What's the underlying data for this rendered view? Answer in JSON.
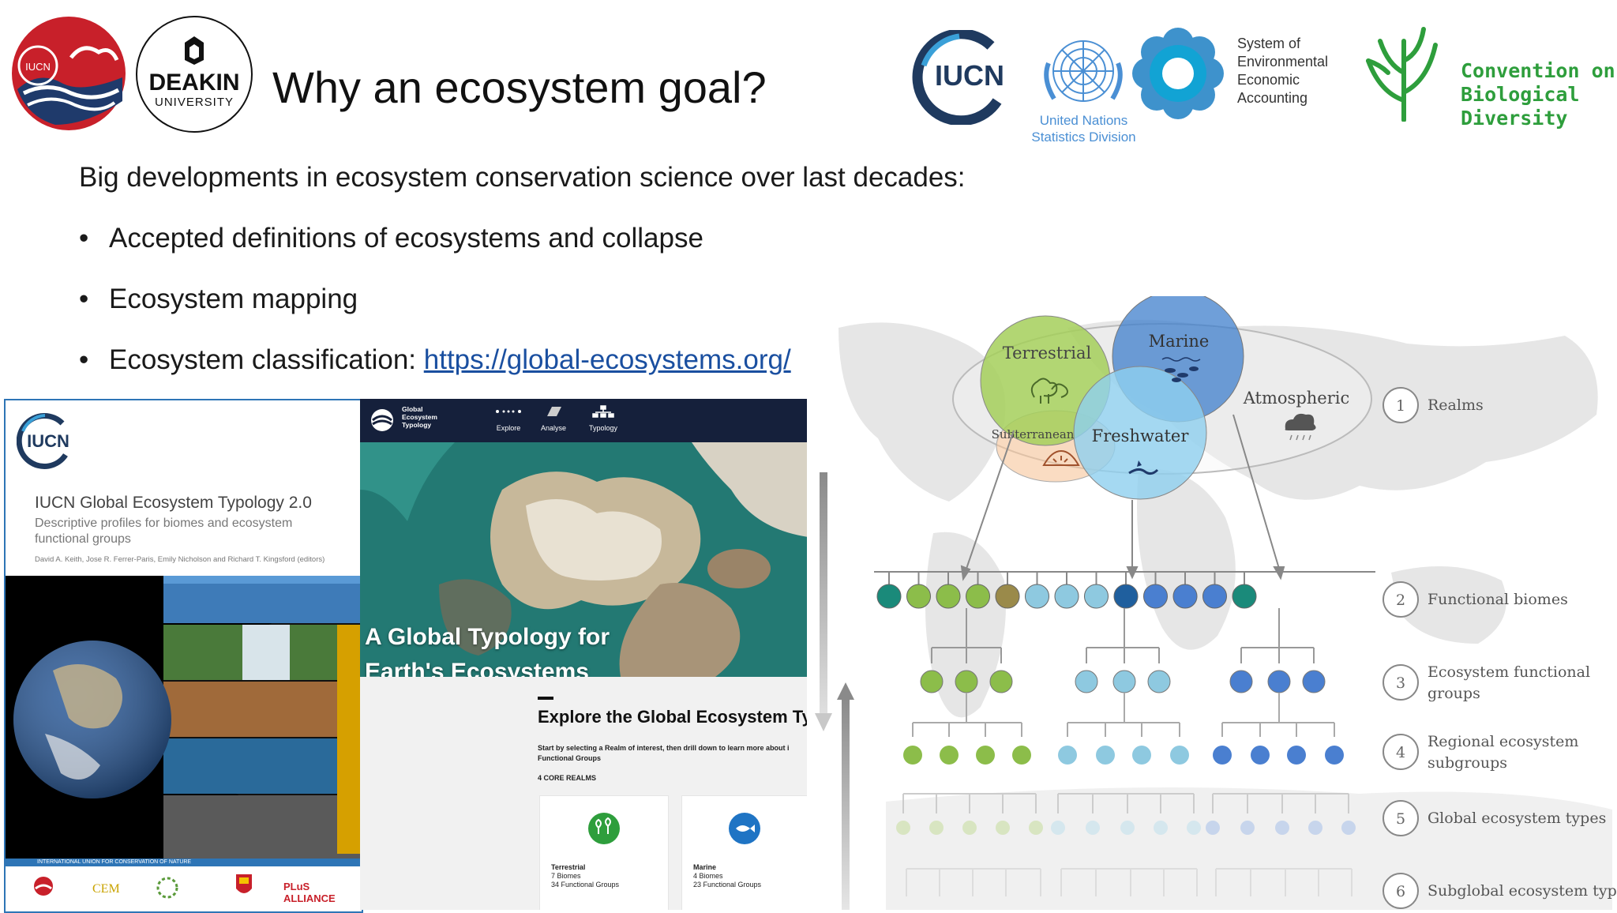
{
  "slide": {
    "title": "Why an ecosystem goal?",
    "intro": "Big developments in ecosystem conservation science over last decades:",
    "bullets": [
      {
        "text": "Accepted definitions of ecosystems and collapse"
      },
      {
        "text": "Ecosystem mapping"
      },
      {
        "text": "Ecosystem classification: ",
        "link": "https://global-ecosystems.org/"
      }
    ]
  },
  "logos": {
    "iucn_small": "IUCN",
    "deakin_name": "DEAKIN",
    "deakin_sub": "UNIVERSITY",
    "iucn": "IUCN",
    "un_line1": "United Nations",
    "un_line2": "Statistics Division",
    "seea": [
      "System of",
      "Environmental",
      "Economic",
      "Accounting"
    ],
    "cbd_line1": "Convention on",
    "cbd_line2": "Biological Diversity",
    "colors": {
      "iucn_blue": "#1f3a5f",
      "cbd_green": "#2e9e3c",
      "un_blue": "#4a8fd4",
      "deakin": "#000000"
    }
  },
  "cover": {
    "logo": "IUCN",
    "title": "IUCN Global Ecosystem Typology 2.0",
    "subtitle": "Descriptive profiles for biomes and ecosystem functional groups",
    "editors": "David A. Keith, Jose R. Ferrer-Paris, Emily Nicholson and Richard T. Kingsford (editors)",
    "footer": "INTERNATIONAL UNION FOR CONSERVATION OF NATURE",
    "partner_logos": [
      "IUCN Red List of Ecosystems",
      "CEM",
      "Centre for Ecosystem Science",
      "UNSW",
      "PLuS ALLIANCE"
    ]
  },
  "website": {
    "brand": [
      "Global",
      "Ecosystem",
      "Typology"
    ],
    "nav": [
      "Explore",
      "Analyse",
      "Typology"
    ],
    "hero_title_line1": "A Global Typology for",
    "hero_title_line2": "Earth's Ecosystems",
    "section_title": "Explore the Global Ecosystem Ty",
    "section_text_line1": "Start by selecting a Realm of interest, then drill down to learn more about i",
    "section_text_line2": "Functional Groups",
    "core_label": "4 CORE REALMS",
    "cards": [
      {
        "name": "Terrestrial",
        "biomes": "7 Biomes",
        "groups": "34 Functional Groups",
        "color": "#2e9e3c",
        "icon": "tree-icon"
      },
      {
        "name": "Marine",
        "biomes": "4 Biomes",
        "groups": "23 Functional Groups",
        "color": "#1f74c4",
        "icon": "fish-icon"
      }
    ]
  },
  "diagram": {
    "realms": [
      "Terrestrial",
      "Marine",
      "Atmospheric",
      "Subterranean",
      "Freshwater"
    ],
    "levels": [
      {
        "num": "1",
        "label": [
          "Realms"
        ]
      },
      {
        "num": "2",
        "label": [
          "Functional  biomes"
        ]
      },
      {
        "num": "3",
        "label": [
          "Ecosystem  functional",
          "groups"
        ]
      },
      {
        "num": "4",
        "label": [
          "Regional  ecosystem",
          "subgroups"
        ]
      },
      {
        "num": "5",
        "label": [
          "Global  ecosystem  types"
        ]
      },
      {
        "num": "6",
        "label": [
          "Subglobal  ecosystem  types"
        ]
      }
    ],
    "biome_colors": [
      "#1a8a7a",
      "#8cbd4a",
      "#8cbd4a",
      "#8cbd4a",
      "#9a8a4a",
      "#8ec9e0",
      "#8ec9e0",
      "#8ec9e0",
      "#1f5f9e",
      "#4a7fd0",
      "#4a7fd0",
      "#4a7fd0",
      "#1a8a7a"
    ]
  }
}
